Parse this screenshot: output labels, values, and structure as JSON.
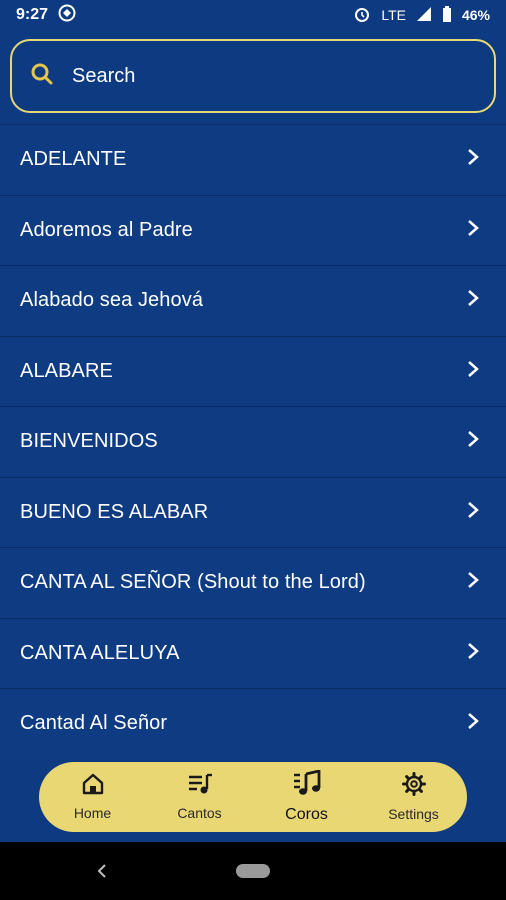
{
  "status_bar": {
    "time": "9:27",
    "network": "LTE",
    "battery": "46%"
  },
  "search": {
    "placeholder": "Search"
  },
  "songs": [
    "ADELANTE",
    "Adoremos al Padre",
    "Alabado sea Jehová",
    "ALABARE",
    "BIENVENIDOS",
    "BUENO ES ALABAR",
    "CANTA AL SEÑOR (Shout to the Lord)",
    "CANTA ALELUYA",
    "Cantad Al Señor"
  ],
  "bottom_nav": {
    "items": [
      {
        "label": "Home",
        "icon": "home-icon"
      },
      {
        "label": "Cantos",
        "icon": "music-list-icon"
      },
      {
        "label": "Coros",
        "icon": "music-note-icon",
        "active": true
      },
      {
        "label": "Settings",
        "icon": "gear-icon"
      }
    ]
  },
  "colors": {
    "background": "#0d3a80",
    "accent": "#e9d774",
    "divider": "#0a2d63"
  }
}
